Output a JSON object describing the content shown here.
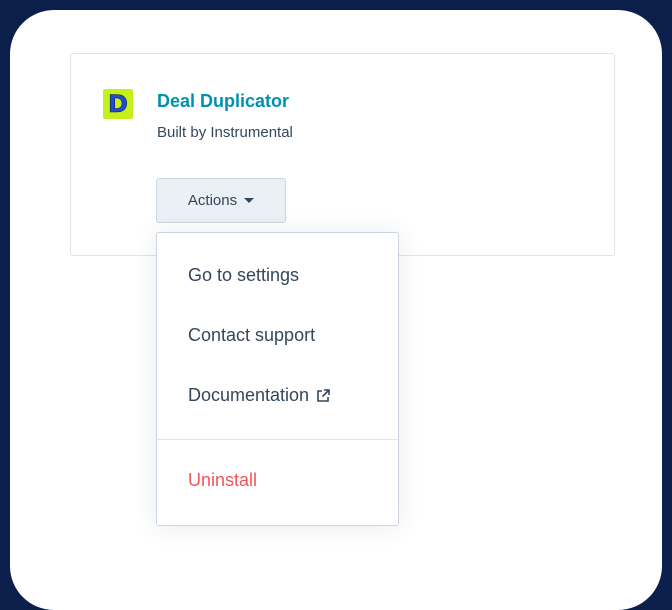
{
  "app": {
    "logo_letter": "D",
    "name": "Deal Duplicator",
    "built_by": "Built by Instrumental"
  },
  "actions": {
    "label": "Actions"
  },
  "menu": {
    "items": [
      {
        "label": "Go to settings"
      },
      {
        "label": "Contact support"
      },
      {
        "label": "Documentation",
        "icon": "external-link-icon"
      },
      {
        "label": "Uninstall"
      }
    ]
  },
  "colors": {
    "background": "#0b1f4a",
    "link": "#0091ae",
    "text": "#33475b",
    "danger": "#f2545b",
    "logo_bg": "#c6f01b",
    "logo_fg": "#1f4bd8"
  }
}
